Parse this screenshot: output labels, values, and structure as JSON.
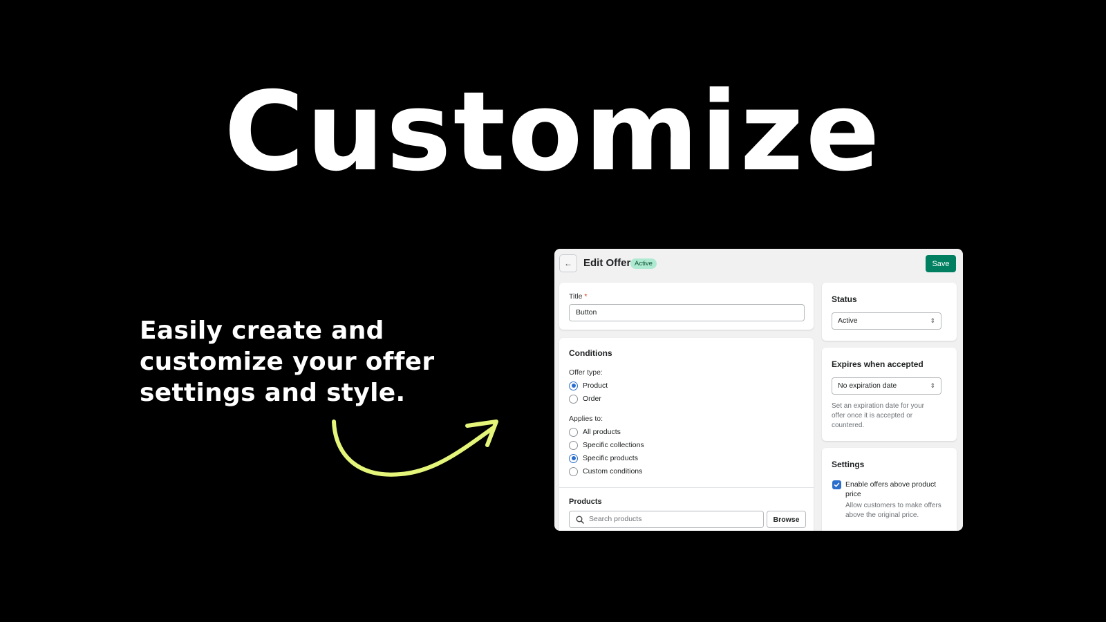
{
  "headline": "Customize",
  "subtext": "Easily create and customize your offer settings and style.",
  "colors": {
    "background": "#000000",
    "arrow": "#e4f57a",
    "save_button": "#008060",
    "badge_bg": "#aee9d1",
    "accent_blue": "#2c6ecb"
  },
  "panel": {
    "header": {
      "back_icon": "arrow-left-icon",
      "title": "Edit Offer",
      "badge": "Active",
      "save_label": "Save"
    },
    "title_card": {
      "label": "Title",
      "required_mark": "*",
      "value": "Button"
    },
    "conditions": {
      "heading": "Conditions",
      "offer_type_label": "Offer type:",
      "offer_types": [
        {
          "label": "Product",
          "selected": true
        },
        {
          "label": "Order",
          "selected": false
        }
      ],
      "applies_to_label": "Applies to:",
      "applies_to": [
        {
          "label": "All products",
          "selected": false
        },
        {
          "label": "Specific collections",
          "selected": false
        },
        {
          "label": "Specific products",
          "selected": true
        },
        {
          "label": "Custom conditions",
          "selected": false
        }
      ],
      "products_heading": "Products",
      "search_placeholder": "Search products",
      "browse_label": "Browse"
    },
    "status": {
      "heading": "Status",
      "selected": "Active"
    },
    "expires": {
      "heading": "Expires when accepted",
      "selected": "No expiration date",
      "help": "Set an expiration date for your offer once it is accepted or countered."
    },
    "settings": {
      "heading": "Settings",
      "checkbox_label": "Enable offers above product price",
      "checkbox_checked": true,
      "checkbox_help": "Allow customers to make offers above the original price."
    }
  }
}
